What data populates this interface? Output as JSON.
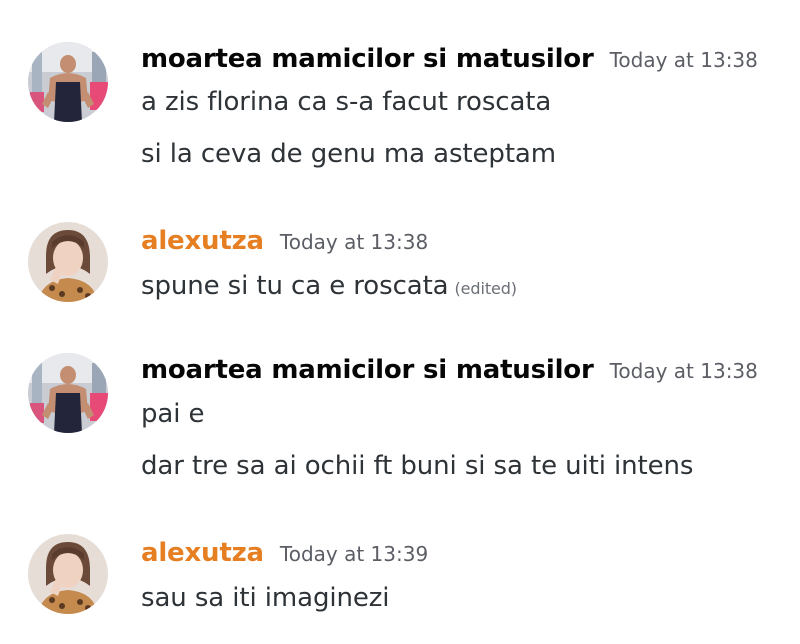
{
  "messages": [
    {
      "username": "moartea mamicilor si matusilor",
      "timestamp": "Today at 13:38",
      "lines": [
        "a zis florina ca s-a facut roscata",
        "si la ceva de genu ma asteptam"
      ]
    },
    {
      "username": "alexutza",
      "username_color": "#e67e22",
      "timestamp": "Today at 13:38",
      "lines": [
        "spune si tu ca e roscata"
      ],
      "edited_label": "(edited)"
    },
    {
      "username": "moartea mamicilor si matusilor",
      "timestamp": "Today at 13:38",
      "lines": [
        "pai e",
        "dar tre sa ai ochii ft buni si sa te uiti intens"
      ]
    },
    {
      "username": "alexutza",
      "username_color": "#e67e22",
      "timestamp": "Today at 13:39",
      "lines": [
        "sau sa iti imaginezi"
      ]
    }
  ],
  "avatars": {
    "user1": "gym-back-photo-avatar",
    "user2": "woman-portrait-avatar"
  }
}
